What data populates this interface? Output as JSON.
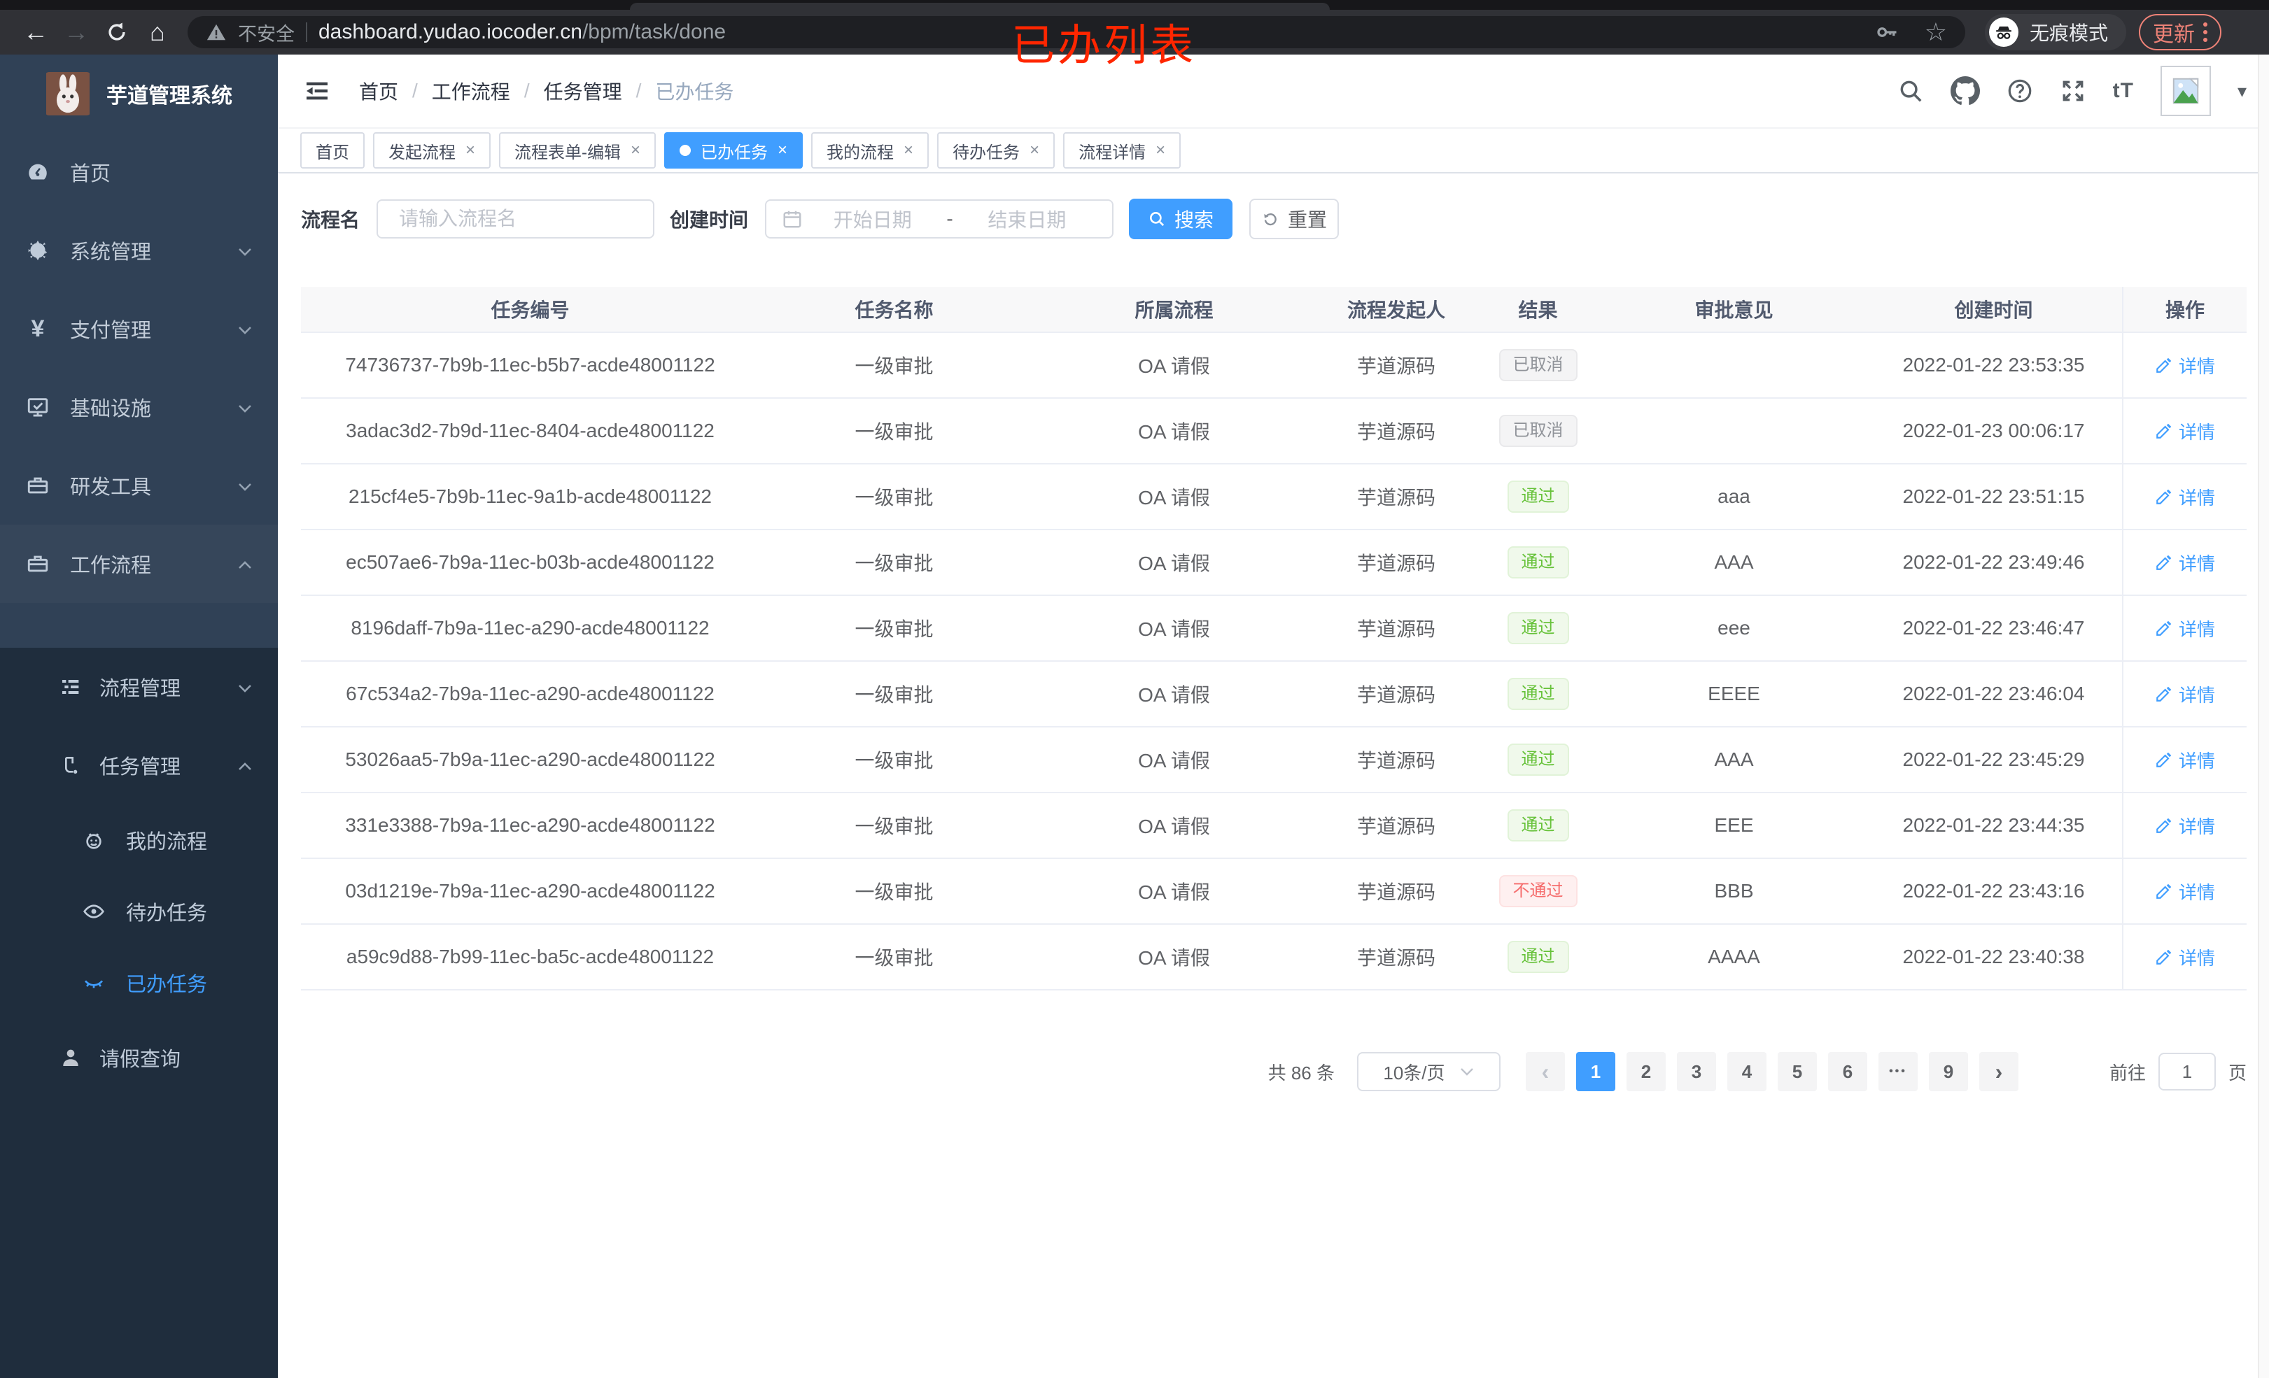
{
  "browser": {
    "security_label": "不安全",
    "url_domain": "dashboard.yudao.iocoder.cn",
    "url_path": "/bpm/task/done",
    "incognito_label": "无痕模式",
    "update_label": "更新",
    "back_glyph": "←",
    "forward_glyph": "→",
    "home_glyph": "⌂",
    "star_glyph": "☆"
  },
  "annotation": {
    "text": "已办列表",
    "color": "#ff2600"
  },
  "sidebar": {
    "title": "芋道管理系统",
    "yen_glyph": "¥",
    "items": [
      {
        "label": "首页"
      },
      {
        "label": "系统管理"
      },
      {
        "label": "支付管理"
      },
      {
        "label": "基础设施"
      },
      {
        "label": "研发工具"
      },
      {
        "label": "工作流程"
      }
    ],
    "submenu": [
      {
        "label": "流程管理"
      },
      {
        "label": "任务管理"
      }
    ],
    "task_children": [
      {
        "label": "我的流程"
      },
      {
        "label": "待办任务"
      },
      {
        "label": "已办任务"
      }
    ],
    "leave_label": "请假查询"
  },
  "header": {
    "breadcrumb": [
      "首页",
      "工作流程",
      "任务管理",
      "已办任务"
    ],
    "separator": "/",
    "font_size_glyph": "tT",
    "caret_glyph": "▾"
  },
  "tabs": [
    {
      "label": "首页",
      "closable": false,
      "active": false
    },
    {
      "label": "发起流程",
      "closable": true,
      "active": false
    },
    {
      "label": "流程表单-编辑",
      "closable": true,
      "active": false
    },
    {
      "label": "已办任务",
      "closable": true,
      "active": true
    },
    {
      "label": "我的流程",
      "closable": true,
      "active": false
    },
    {
      "label": "待办任务",
      "closable": true,
      "active": false
    },
    {
      "label": "流程详情",
      "closable": true,
      "active": false
    }
  ],
  "tab_close_glyph": "×",
  "filters": {
    "name_label": "流程名",
    "name_placeholder": "请输入流程名",
    "time_label": "创建时间",
    "start_placeholder": "开始日期",
    "range_separator": "-",
    "end_placeholder": "结束日期",
    "search_label": "搜索",
    "reset_label": "重置"
  },
  "table": {
    "columns": [
      "任务编号",
      "任务名称",
      "所属流程",
      "流程发起人",
      "结果",
      "审批意见",
      "创建时间",
      "操作"
    ],
    "action_label": "详情",
    "rows": [
      {
        "id": "74736737-7b9b-11ec-b5b7-acde48001122",
        "name": "一级审批",
        "process": "OA 请假",
        "starter": "芋道源码",
        "result": "已取消",
        "result_type": "info",
        "comment": "",
        "time": "2022-01-22 23:53:35"
      },
      {
        "id": "3adac3d2-7b9d-11ec-8404-acde48001122",
        "name": "一级审批",
        "process": "OA 请假",
        "starter": "芋道源码",
        "result": "已取消",
        "result_type": "info",
        "comment": "",
        "time": "2022-01-23 00:06:17"
      },
      {
        "id": "215cf4e5-7b9b-11ec-9a1b-acde48001122",
        "name": "一级审批",
        "process": "OA 请假",
        "starter": "芋道源码",
        "result": "通过",
        "result_type": "success",
        "comment": "aaa",
        "time": "2022-01-22 23:51:15"
      },
      {
        "id": "ec507ae6-7b9a-11ec-b03b-acde48001122",
        "name": "一级审批",
        "process": "OA 请假",
        "starter": "芋道源码",
        "result": "通过",
        "result_type": "success",
        "comment": "AAA",
        "time": "2022-01-22 23:49:46"
      },
      {
        "id": "8196daff-7b9a-11ec-a290-acde48001122",
        "name": "一级审批",
        "process": "OA 请假",
        "starter": "芋道源码",
        "result": "通过",
        "result_type": "success",
        "comment": "eee",
        "time": "2022-01-22 23:46:47"
      },
      {
        "id": "67c534a2-7b9a-11ec-a290-acde48001122",
        "name": "一级审批",
        "process": "OA 请假",
        "starter": "芋道源码",
        "result": "通过",
        "result_type": "success",
        "comment": "EEEE",
        "time": "2022-01-22 23:46:04"
      },
      {
        "id": "53026aa5-7b9a-11ec-a290-acde48001122",
        "name": "一级审批",
        "process": "OA 请假",
        "starter": "芋道源码",
        "result": "通过",
        "result_type": "success",
        "comment": "AAA",
        "time": "2022-01-22 23:45:29"
      },
      {
        "id": "331e3388-7b9a-11ec-a290-acde48001122",
        "name": "一级审批",
        "process": "OA 请假",
        "starter": "芋道源码",
        "result": "通过",
        "result_type": "success",
        "comment": "EEE",
        "time": "2022-01-22 23:44:35"
      },
      {
        "id": "03d1219e-7b9a-11ec-a290-acde48001122",
        "name": "一级审批",
        "process": "OA 请假",
        "starter": "芋道源码",
        "result": "不通过",
        "result_type": "danger",
        "comment": "BBB",
        "time": "2022-01-22 23:43:16"
      },
      {
        "id": "a59c9d88-7b99-11ec-ba5c-acde48001122",
        "name": "一级审批",
        "process": "OA 请假",
        "starter": "芋道源码",
        "result": "通过",
        "result_type": "success",
        "comment": "AAAA",
        "time": "2022-01-22 23:40:38"
      }
    ]
  },
  "pagination": {
    "total_label": "共 86 条",
    "page_size": "10条/页",
    "prev_glyph": "‹",
    "next_glyph": "›",
    "pages": [
      "1",
      "2",
      "3",
      "4",
      "5",
      "6"
    ],
    "ellipsis": "•••",
    "last_page": "9",
    "goto_label": "前往",
    "goto_value": "1",
    "goto_unit": "页"
  },
  "colors": {
    "accent": "#409eff",
    "sidebar_bg": "#304156",
    "submenu_bg": "#1f2d3d",
    "success": "#67c23a",
    "danger": "#f56c6c",
    "info": "#909399",
    "annotation": "#ff2600"
  }
}
